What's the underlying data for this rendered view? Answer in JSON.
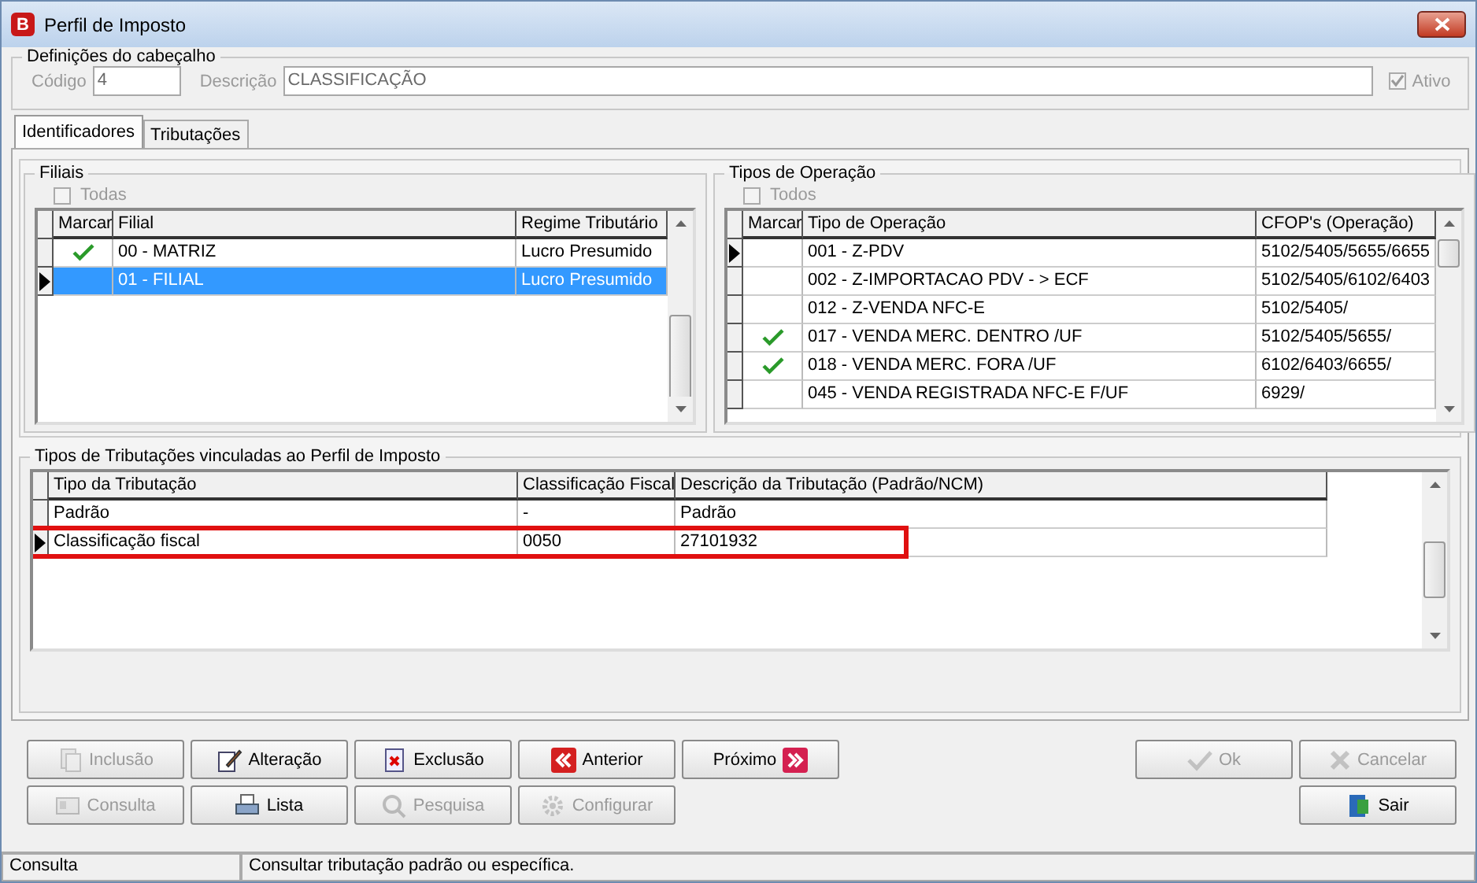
{
  "window": {
    "title": "Perfil de Imposto",
    "app_letter": "B"
  },
  "header": {
    "title": "Definições do cabeçalho",
    "code_label": "Código",
    "code_value": "4",
    "description_label": "Descrição",
    "description_value": "CLASSIFICAÇÃO",
    "active_label": "Ativo",
    "active_checked": true,
    "active_disabled": true
  },
  "tabs": [
    {
      "label": "Identificadores",
      "selected": true
    },
    {
      "label": "Tributações",
      "selected": false
    }
  ],
  "branches": {
    "title": "Filiais",
    "all_label": "Todas",
    "all_checked": false,
    "mark_column": "Marcar",
    "columns": [
      "Filial",
      "Regime Tributário"
    ],
    "rows": [
      {
        "checked": true,
        "current": false,
        "selected": false,
        "cells": [
          "00 - MATRIZ",
          "Lucro Presumido"
        ]
      },
      {
        "checked": false,
        "current": true,
        "selected": true,
        "cells": [
          "01 - FILIAL",
          "Lucro Presumido"
        ]
      }
    ]
  },
  "operations": {
    "title": "Tipos de Operação",
    "all_label": "Todos",
    "all_checked": false,
    "mark_column": "Marcar",
    "columns": [
      "Tipo de Operação",
      "CFOP's (Operação)"
    ],
    "rows": [
      {
        "checked": false,
        "current": true,
        "selected": false,
        "cells": [
          "001 - Z-PDV",
          "5102/5405/5655/6655"
        ]
      },
      {
        "checked": false,
        "current": false,
        "selected": false,
        "cells": [
          "002 - Z-IMPORTACAO PDV - > ECF",
          "5102/5405/6102/6403"
        ]
      },
      {
        "checked": false,
        "current": false,
        "selected": false,
        "cells": [
          "012 - Z-VENDA NFC-E",
          "5102/5405/"
        ]
      },
      {
        "checked": true,
        "current": false,
        "selected": false,
        "cells": [
          "017 - VENDA MERC. DENTRO /UF",
          "5102/5405/5655/"
        ]
      },
      {
        "checked": true,
        "current": false,
        "selected": false,
        "cells": [
          "018 - VENDA MERC. FORA /UF",
          "6102/6403/6655/"
        ]
      },
      {
        "checked": false,
        "current": false,
        "selected": false,
        "cells": [
          "045 - VENDA REGISTRADA NFC-E F/UF",
          "6929/"
        ]
      }
    ]
  },
  "taxes": {
    "title": "Tipos de Tributações vinculadas ao Perfil de Imposto",
    "columns": [
      "Tipo da Tributação",
      "Classificação Fiscal",
      "Descrição da Tributação (Padrão/NCM)"
    ],
    "rows": [
      {
        "current": false,
        "highlighted": false,
        "cells": [
          "Padrão",
          "-",
          "Padrão"
        ]
      },
      {
        "current": true,
        "highlighted": true,
        "cells": [
          "Classificação fiscal",
          "0050",
          "27101932"
        ]
      }
    ]
  },
  "buttons_left": [
    [
      {
        "label": "Inclusão",
        "kind": "add",
        "disabled": true
      },
      {
        "label": "Alteração",
        "kind": "edit",
        "disabled": false
      },
      {
        "label": "Exclusão",
        "kind": "delete",
        "disabled": false
      },
      {
        "label": "Anterior",
        "kind": "prev",
        "disabled": false
      },
      {
        "label": "Próximo",
        "kind": "next",
        "disabled": false
      }
    ],
    [
      {
        "label": "Consulta",
        "kind": "view",
        "disabled": true
      },
      {
        "label": "Lista",
        "kind": "print",
        "disabled": false
      },
      {
        "label": "Pesquisa",
        "kind": "search",
        "disabled": true
      },
      {
        "label": "Configurar",
        "kind": "gear",
        "disabled": true
      }
    ]
  ],
  "buttons_right": [
    [
      {
        "label": "Ok",
        "kind": "ok",
        "disabled": true
      },
      {
        "label": "Cancelar",
        "kind": "cancel",
        "disabled": true
      }
    ],
    [
      {
        "label": "Sair",
        "kind": "exit",
        "disabled": false
      }
    ]
  ],
  "status_bar": [
    "Consulta",
    "Consultar tributação padrão ou específica."
  ]
}
